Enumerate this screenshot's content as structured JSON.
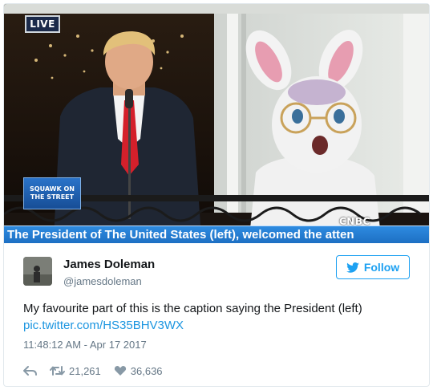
{
  "media": {
    "live_label": "LIVE",
    "show_logo_line1": "SQUAWK ON",
    "show_logo_line2": "THE STREET",
    "network_label": "CNBC",
    "chyron": "The President of The United States (left), welcomed the atten"
  },
  "author": {
    "name": "James Doleman",
    "handle": "@jamesdoleman"
  },
  "follow_label": "Follow",
  "tweet": {
    "text": "My favourite part of this is the caption saying the President (left)",
    "link": "pic.twitter.com/HS35BHV3WX",
    "timestamp": "11:48:12 AM - Apr 17 2017"
  },
  "stats": {
    "retweets": "21,261",
    "likes": "36,636"
  },
  "colors": {
    "accent": "#1da1f2",
    "link": "#1b95e0",
    "chyron": "#1d6fc3",
    "muted": "#657786"
  },
  "icons": [
    "reply-icon",
    "retweet-icon",
    "like-icon",
    "twitter-bird-icon"
  ]
}
